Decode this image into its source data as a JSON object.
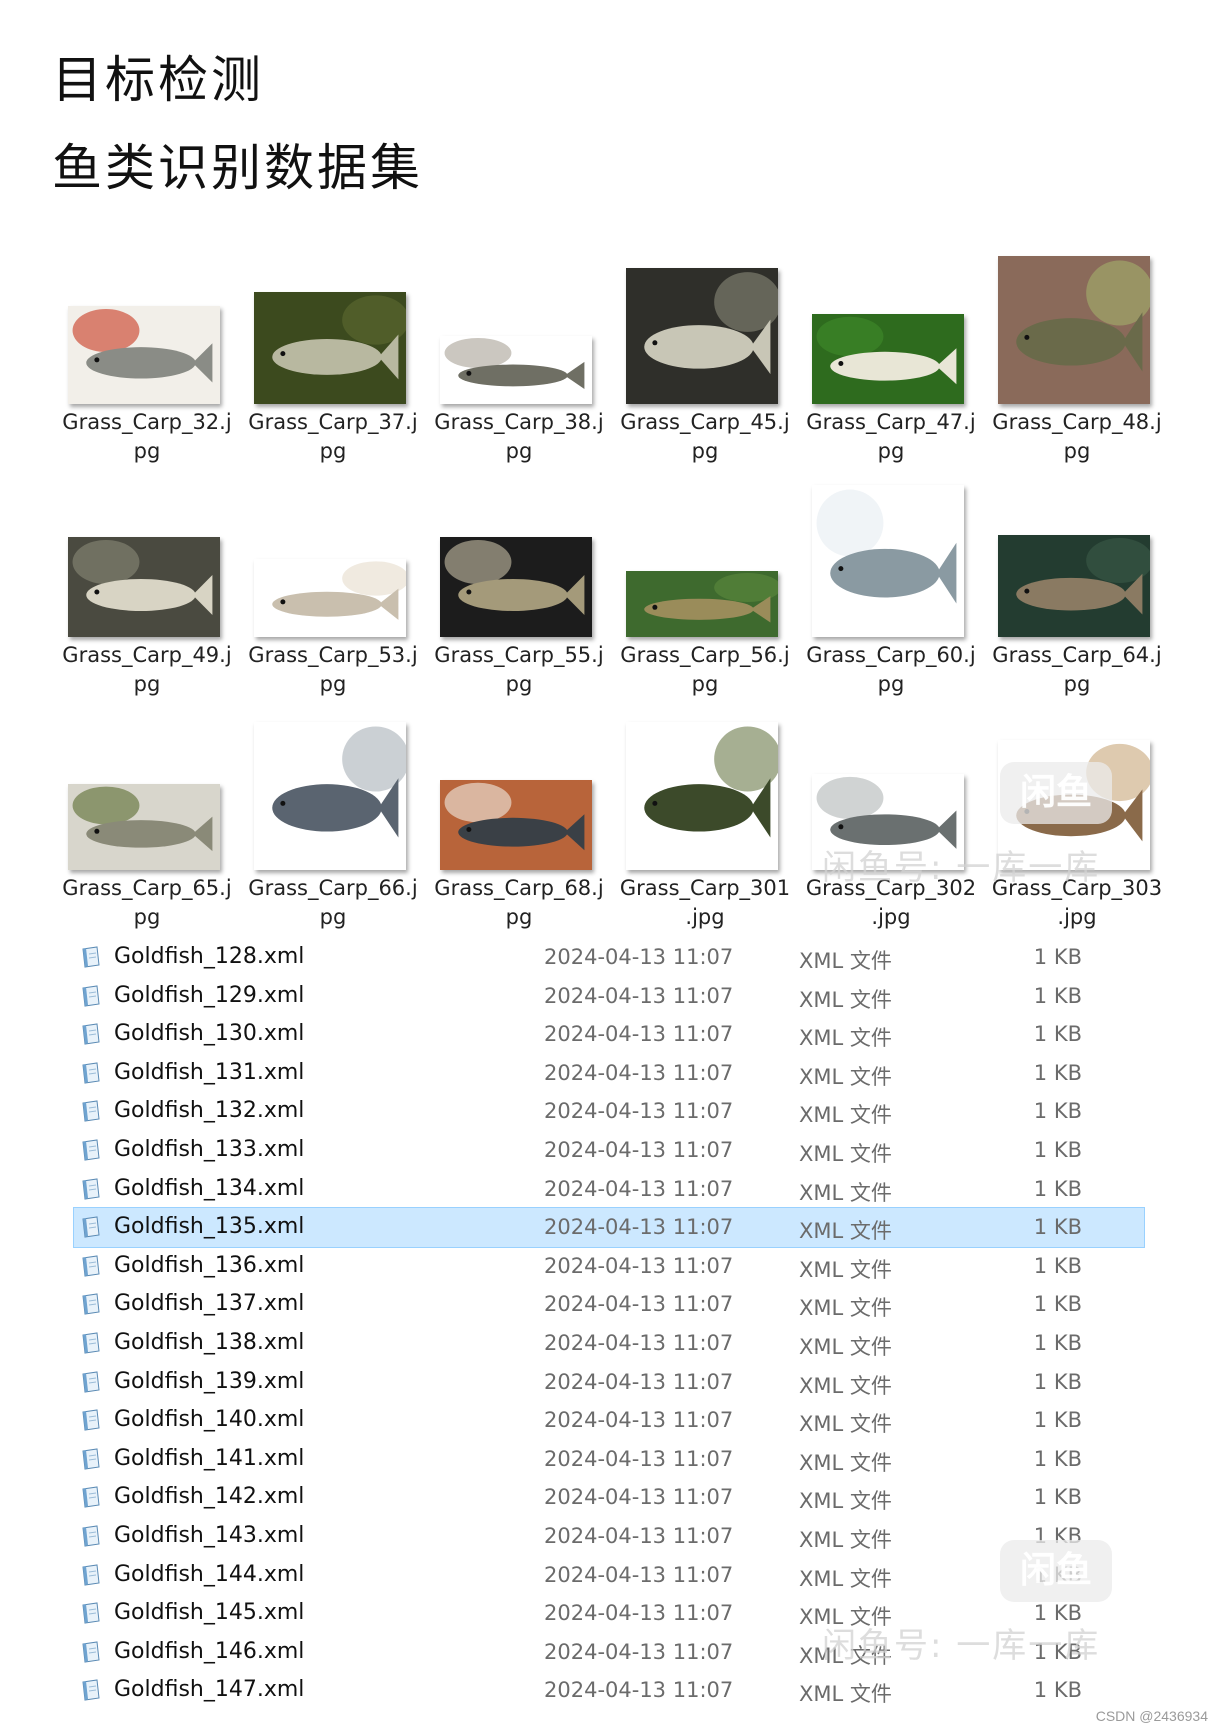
{
  "header": {
    "title": "目标检测",
    "subtitle": "鱼类识别数据集"
  },
  "thumbnails": [
    {
      "name_line1": "Grass_Carp_32.j",
      "name_line2": "pg"
    },
    {
      "name_line1": "Grass_Carp_37.j",
      "name_line2": "pg"
    },
    {
      "name_line1": "Grass_Carp_38.j",
      "name_line2": "pg"
    },
    {
      "name_line1": "Grass_Carp_45.j",
      "name_line2": "pg"
    },
    {
      "name_line1": "Grass_Carp_47.j",
      "name_line2": "pg"
    },
    {
      "name_line1": "Grass_Carp_48.j",
      "name_line2": "pg"
    },
    {
      "name_line1": "Grass_Carp_49.j",
      "name_line2": "pg"
    },
    {
      "name_line1": "Grass_Carp_53.j",
      "name_line2": "pg"
    },
    {
      "name_line1": "Grass_Carp_55.j",
      "name_line2": "pg"
    },
    {
      "name_line1": "Grass_Carp_56.j",
      "name_line2": "pg"
    },
    {
      "name_line1": "Grass_Carp_60.j",
      "name_line2": "pg"
    },
    {
      "name_line1": "Grass_Carp_64.j",
      "name_line2": "pg"
    },
    {
      "name_line1": "Grass_Carp_65.j",
      "name_line2": "pg"
    },
    {
      "name_line1": "Grass_Carp_66.j",
      "name_line2": "pg"
    },
    {
      "name_line1": "Grass_Carp_68.j",
      "name_line2": "pg"
    },
    {
      "name_line1": "Grass_Carp_301",
      "name_line2": ".jpg"
    },
    {
      "name_line1": "Grass_Carp_302",
      "name_line2": ".jpg"
    },
    {
      "name_line1": "Grass_Carp_303",
      "name_line2": ".jpg"
    }
  ],
  "files": [
    {
      "name": "Goldfish_128.xml",
      "date": "2024-04-13 11:07",
      "type": "XML 文件",
      "size": "1 KB"
    },
    {
      "name": "Goldfish_129.xml",
      "date": "2024-04-13 11:07",
      "type": "XML 文件",
      "size": "1 KB"
    },
    {
      "name": "Goldfish_130.xml",
      "date": "2024-04-13 11:07",
      "type": "XML 文件",
      "size": "1 KB"
    },
    {
      "name": "Goldfish_131.xml",
      "date": "2024-04-13 11:07",
      "type": "XML 文件",
      "size": "1 KB"
    },
    {
      "name": "Goldfish_132.xml",
      "date": "2024-04-13 11:07",
      "type": "XML 文件",
      "size": "1 KB"
    },
    {
      "name": "Goldfish_133.xml",
      "date": "2024-04-13 11:07",
      "type": "XML 文件",
      "size": "1 KB"
    },
    {
      "name": "Goldfish_134.xml",
      "date": "2024-04-13 11:07",
      "type": "XML 文件",
      "size": "1 KB"
    },
    {
      "name": "Goldfish_135.xml",
      "date": "2024-04-13 11:07",
      "type": "XML 文件",
      "size": "1 KB",
      "selected": true
    },
    {
      "name": "Goldfish_136.xml",
      "date": "2024-04-13 11:07",
      "type": "XML 文件",
      "size": "1 KB"
    },
    {
      "name": "Goldfish_137.xml",
      "date": "2024-04-13 11:07",
      "type": "XML 文件",
      "size": "1 KB"
    },
    {
      "name": "Goldfish_138.xml",
      "date": "2024-04-13 11:07",
      "type": "XML 文件",
      "size": "1 KB"
    },
    {
      "name": "Goldfish_139.xml",
      "date": "2024-04-13 11:07",
      "type": "XML 文件",
      "size": "1 KB"
    },
    {
      "name": "Goldfish_140.xml",
      "date": "2024-04-13 11:07",
      "type": "XML 文件",
      "size": "1 KB"
    },
    {
      "name": "Goldfish_141.xml",
      "date": "2024-04-13 11:07",
      "type": "XML 文件",
      "size": "1 KB"
    },
    {
      "name": "Goldfish_142.xml",
      "date": "2024-04-13 11:07",
      "type": "XML 文件",
      "size": "1 KB"
    },
    {
      "name": "Goldfish_143.xml",
      "date": "2024-04-13 11:07",
      "type": "XML 文件",
      "size": "1 KB"
    },
    {
      "name": "Goldfish_144.xml",
      "date": "2024-04-13 11:07",
      "type": "XML 文件",
      "size": "1 KB"
    },
    {
      "name": "Goldfish_145.xml",
      "date": "2024-04-13 11:07",
      "type": "XML 文件",
      "size": "1 KB"
    },
    {
      "name": "Goldfish_146.xml",
      "date": "2024-04-13 11:07",
      "type": "XML 文件",
      "size": "1 KB"
    },
    {
      "name": "Goldfish_147.xml",
      "date": "2024-04-13 11:07",
      "type": "XML 文件",
      "size": "1 KB"
    }
  ],
  "watermark": {
    "badge": "闲鱼",
    "text": "闲鱼号: 一库一库"
  },
  "footer": {
    "credit": "CSDN @2436934"
  },
  "colors": {
    "selection_bg": "#cce8ff",
    "selection_border": "#99d1ff",
    "meta_text": "#6b6b6b"
  },
  "icons": {
    "file": "xml-file-icon"
  }
}
